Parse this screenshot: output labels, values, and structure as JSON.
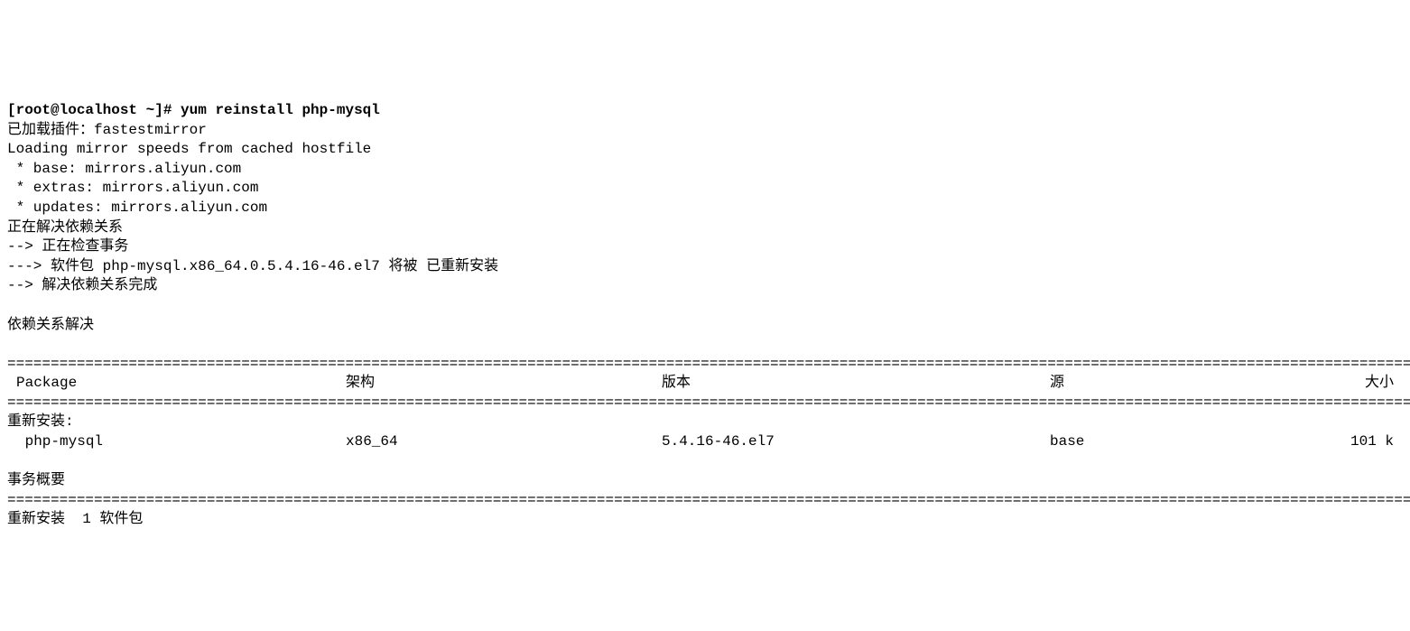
{
  "prompt": "[root@localhost ~]# ",
  "command": "yum reinstall php-mysql",
  "lines": {
    "plugins_loaded": "已加载插件：fastestmirror",
    "loading_mirror": "Loading mirror speeds from cached hostfile",
    "mirror_base": " * base: mirrors.aliyun.com",
    "mirror_extras": " * extras: mirrors.aliyun.com",
    "mirror_updates": " * updates: mirrors.aliyun.com",
    "resolving_deps": "正在解决依赖关系",
    "checking_trans": "--> 正在检查事务",
    "pkg_reinstall": "---> 软件包 php-mysql.x86_64.0.5.4.16-46.el7 将被 已重新安装",
    "finished_deps": "--> 解决依赖关系完成",
    "deps_resolved": "依赖关系解决"
  },
  "table": {
    "headers": {
      "package": "Package",
      "arch": "架构",
      "version": "版本",
      "source": "源",
      "size": "大小"
    },
    "section_label": "重新安装:",
    "row": {
      "package": " php-mysql",
      "arch": "x86_64",
      "version": "5.4.16-46.el7",
      "source": "base",
      "size": "101 k"
    }
  },
  "summary": {
    "title": "事务概要",
    "line": "重新安装  1 软件包"
  },
  "divider": "================================================================================================================================================================================================================================================================================"
}
